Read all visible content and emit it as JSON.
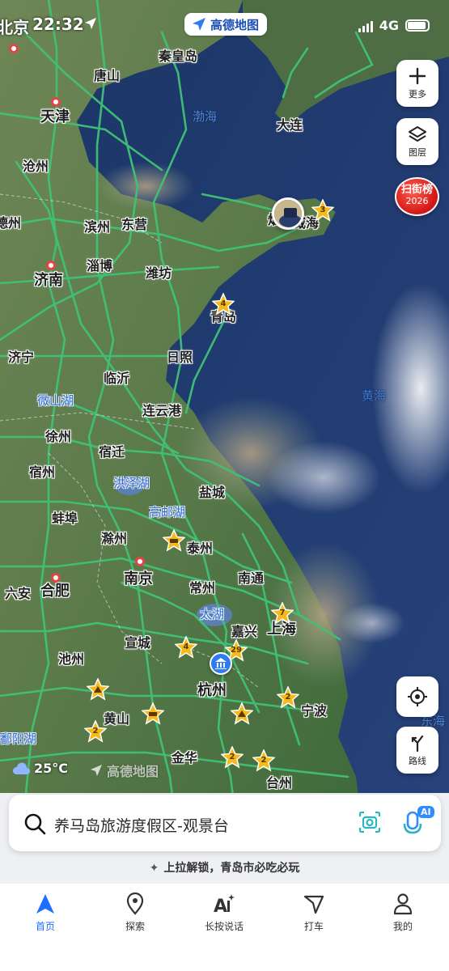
{
  "status_bar": {
    "city": "北京",
    "time": "22:32",
    "app_brand": "高德地图",
    "network": "4G"
  },
  "map": {
    "cities": [
      {
        "name": "秦皇岛",
        "size": "normal"
      },
      {
        "name": "唐山",
        "size": "normal"
      },
      {
        "name": "大连",
        "size": "normal"
      },
      {
        "name": "天津",
        "size": "big"
      },
      {
        "name": "沧州",
        "size": "normal"
      },
      {
        "name": "德州",
        "size": "normal"
      },
      {
        "name": "滨州",
        "size": "normal"
      },
      {
        "name": "东营",
        "size": "normal"
      },
      {
        "name": "烟台",
        "size": "normal"
      },
      {
        "name": "威海",
        "size": "normal"
      },
      {
        "name": "淄博",
        "size": "normal"
      },
      {
        "name": "济南",
        "size": "big"
      },
      {
        "name": "潍坊",
        "size": "normal"
      },
      {
        "name": "青岛",
        "size": "normal"
      },
      {
        "name": "济宁",
        "size": "normal"
      },
      {
        "name": "日照",
        "size": "normal"
      },
      {
        "name": "临沂",
        "size": "normal"
      },
      {
        "name": "连云港",
        "size": "normal"
      },
      {
        "name": "徐州",
        "size": "normal"
      },
      {
        "name": "宿迁",
        "size": "normal"
      },
      {
        "name": "宿州",
        "size": "normal"
      },
      {
        "name": "盐城",
        "size": "normal"
      },
      {
        "name": "蚌埠",
        "size": "normal"
      },
      {
        "name": "滁州",
        "size": "normal"
      },
      {
        "name": "泰州",
        "size": "normal"
      },
      {
        "name": "六安",
        "size": "normal"
      },
      {
        "name": "合肥",
        "size": "big"
      },
      {
        "name": "南京",
        "size": "big"
      },
      {
        "name": "常州",
        "size": "normal"
      },
      {
        "name": "南通",
        "size": "normal"
      },
      {
        "name": "嘉兴",
        "size": "normal"
      },
      {
        "name": "上海",
        "size": "big"
      },
      {
        "name": "宣城",
        "size": "normal"
      },
      {
        "name": "池州",
        "size": "normal"
      },
      {
        "name": "杭州",
        "size": "big"
      },
      {
        "name": "黄山",
        "size": "normal"
      },
      {
        "name": "宁波",
        "size": "normal"
      },
      {
        "name": "金华",
        "size": "normal"
      },
      {
        "name": "台州",
        "size": "normal"
      }
    ],
    "lakes": [
      "微山湖",
      "洪泽湖",
      "高邮湖",
      "太湖",
      "鄱阳湖"
    ],
    "seas": [
      "渤海",
      "黄海",
      "东海"
    ],
    "markers": [
      {
        "label": "3"
      },
      {
        "label": "4"
      },
      {
        "label": "7"
      },
      {
        "label": "4"
      },
      {
        "label": "29"
      },
      {
        "label": "2"
      },
      {
        "label": "2"
      },
      {
        "label": "2"
      },
      {
        "label": "2"
      }
    ]
  },
  "controls": {
    "more_label": "更多",
    "layers_label": "图层",
    "scan_badge_title": "扫街榜",
    "scan_badge_year": "2026",
    "route_label": "路线"
  },
  "weather": {
    "temperature": "25°C"
  },
  "watermark": "高德地图",
  "search": {
    "text": "养马岛旅游度假区-观景台",
    "ai_tag": "AI"
  },
  "hint": "上拉解锁，青岛市必吃必玩",
  "tabs": [
    {
      "label": "首页",
      "icon": "navigation-arrow-icon",
      "active": true
    },
    {
      "label": "探索",
      "icon": "location-pin-icon",
      "active": false
    },
    {
      "label": "长按说话",
      "icon": "ai-voice-icon",
      "active": false
    },
    {
      "label": "打车",
      "icon": "taxi-flag-icon",
      "active": false
    },
    {
      "label": "我的",
      "icon": "profile-icon",
      "active": false
    }
  ],
  "colors": {
    "accent": "#1f6fff",
    "road": "#3fc275",
    "sea": "#1f3d7a",
    "land": "#5f7a4e",
    "badge_red": "#d01616",
    "marker_gold": "#f6b91c"
  }
}
